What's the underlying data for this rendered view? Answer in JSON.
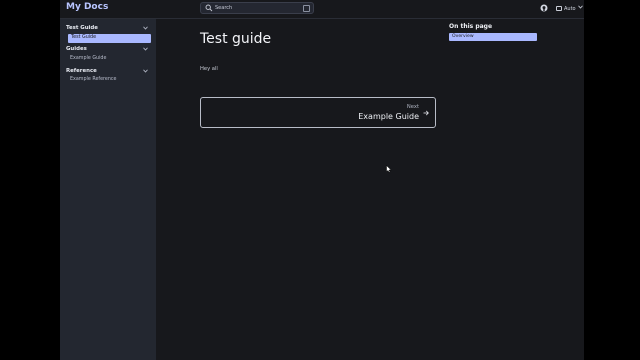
{
  "header": {
    "site_title": "My Docs",
    "search_placeholder": "Search",
    "theme_label": "Auto"
  },
  "sidebar": {
    "groups": [
      {
        "title": "Test Guide",
        "items": [
          "Test Guide"
        ],
        "active": "Test Guide"
      },
      {
        "title": "Guides",
        "items": [
          "Example Guide"
        ]
      },
      {
        "title": "Reference",
        "items": [
          "Example Reference"
        ]
      }
    ]
  },
  "main": {
    "title": "Test guide",
    "body": "Hey all",
    "next": {
      "label": "Next",
      "title": "Example Guide"
    }
  },
  "toc": {
    "title": "On this page",
    "items": [
      "Overview"
    ]
  },
  "colors": {
    "accent": "#a9b8ff",
    "background": "#17181c",
    "sidebar": "#232730"
  },
  "icons": [
    "search-icon",
    "keyboard-shortcut-icon",
    "github-icon",
    "monitor-icon",
    "chevron-down-icon",
    "arrow-right-icon",
    "mouse-pointer-icon"
  ]
}
